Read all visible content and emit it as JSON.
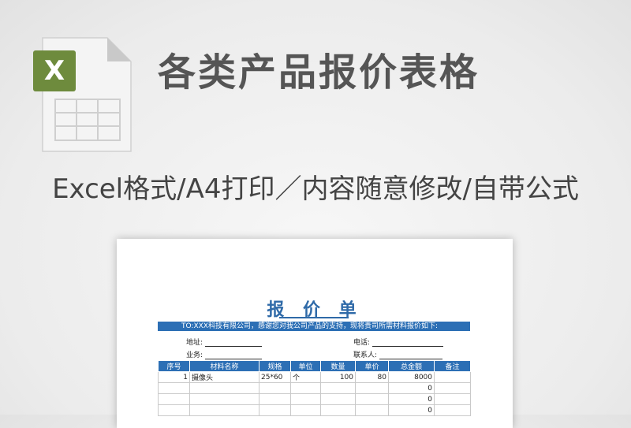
{
  "header": {
    "title": "各类产品报价表格",
    "subtitle": "Excel格式/A4打印／内容随意修改/自带公式",
    "icon": "excel-file-icon",
    "icon_badge_text": "X",
    "icon_color": "#6e8b3d"
  },
  "sheet": {
    "title": "报 价 单",
    "to_line": "TO:XXX科技有限公司，感谢您对我公司产品的支持，现将贵司所需材料报价如下:",
    "fields": {
      "address_label": "地址:",
      "phone_label": "电话:",
      "salesman_label": "业务:",
      "contact_label": "联系人:"
    },
    "columns": [
      "序号",
      "材料名称",
      "规格",
      "单位",
      "数量",
      "单价",
      "总金额",
      "备注"
    ],
    "rows": [
      [
        "1",
        "摄像头",
        "25*60",
        "个",
        "100",
        "80",
        "8000",
        ""
      ],
      [
        "",
        "",
        "",
        "",
        "",
        "",
        "0",
        ""
      ],
      [
        "",
        "",
        "",
        "",
        "",
        "",
        "0",
        ""
      ],
      [
        "",
        "",
        "",
        "",
        "",
        "",
        "0",
        ""
      ]
    ],
    "accent_color": "#2c6fb5"
  }
}
